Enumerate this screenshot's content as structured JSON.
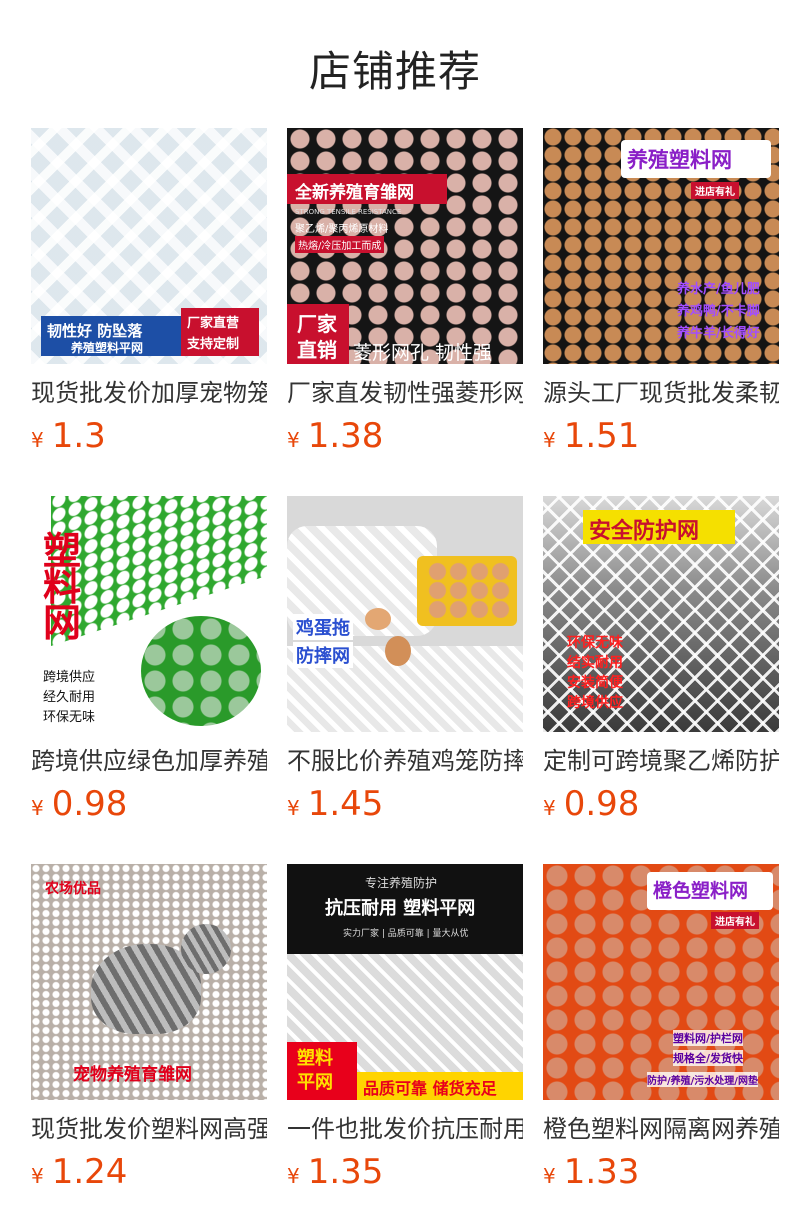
{
  "page": {
    "title": "店铺推荐",
    "currency": "¥"
  },
  "products": [
    {
      "name": "现货批发价加厚宠物笼防坠落塑料平网",
      "price": "1.3",
      "overlay": [
        "韧性好 防坠落",
        "养殖塑料平网",
        "厂家直营",
        "支持定制"
      ],
      "colors": {
        "bg": "#eef3f6",
        "mesh": "#ffffff"
      }
    },
    {
      "name": "厂家直发韧性强菱形网孔全新养殖育雏网",
      "price": "1.38",
      "overlay": [
        "全新养殖育雏网",
        "STRONG TENSILE RESISTANCE",
        "聚乙烯/聚丙烯原材料",
        "热熔/冷压加工而成",
        "厂家",
        "直销",
        "菱形网孔 韧性强"
      ],
      "colors": {
        "bg": "#2a2a2a",
        "mesh": "#111111"
      }
    },
    {
      "name": "源头工厂现货批发柔韧养殖塑料网",
      "price": "1.51",
      "overlay": [
        "养殖塑料网",
        "进店有礼",
        "养水产/鱼儿肥",
        "养鸡鸭/不卡脚",
        "养牛羊/长得好"
      ],
      "colors": {
        "bg": "#c88a55",
        "mesh": "#111111"
      }
    },
    {
      "name": "跨境供应绿色加厚养殖塑料网",
      "price": "0.98",
      "overlay": [
        "塑",
        "料",
        "网",
        "跨境供应",
        "经久耐用",
        "环保无味"
      ],
      "colors": {
        "bg": "#ffffff",
        "mesh": "#2fa82f"
      }
    },
    {
      "name": "不服比价养殖鸡笼防摔鸡蛋拖网",
      "price": "1.45",
      "overlay": [
        "鸡蛋拖",
        "防摔网"
      ],
      "colors": {
        "bg": "#d7d7d7",
        "mesh": "#ffffff"
      }
    },
    {
      "name": "定制可跨境聚乙烯防护塑料网",
      "price": "0.98",
      "overlay": [
        "安全防护网",
        "环保无味",
        "结实耐用",
        "安装简便",
        "跨境供应"
      ],
      "colors": {
        "bg": "#3a3a3a",
        "mesh": "#f2f2f2"
      }
    },
    {
      "name": "现货批发价塑料网高强度宠物养殖育雏网",
      "price": "1.24",
      "overlay": [
        "农场优品",
        "宠物养殖育雏网"
      ],
      "colors": {
        "bg": "#cfc6bd",
        "mesh": "#ffffff"
      }
    },
    {
      "name": "一件也批发价抗压耐用塑料平网",
      "price": "1.35",
      "overlay": [
        "专注养殖防护",
        "抗压耐用 塑料平网",
        "实力厂家 | 品质可靠 | 量大从优",
        "塑料",
        "平网",
        "品质可靠 储货充足"
      ],
      "colors": {
        "bg": "#1a1a1a",
        "mesh": "#f4f4f4"
      }
    },
    {
      "name": "橙色塑料网隔离网养殖防护网",
      "price": "1.33",
      "overlay": [
        "橙色塑料网",
        "进店有礼",
        "塑料网/护栏网",
        "规格全/发货快",
        "防护/养殖/污水处理/网垫"
      ],
      "colors": {
        "bg": "#e8501e",
        "mesh": "#c3300c"
      }
    }
  ]
}
